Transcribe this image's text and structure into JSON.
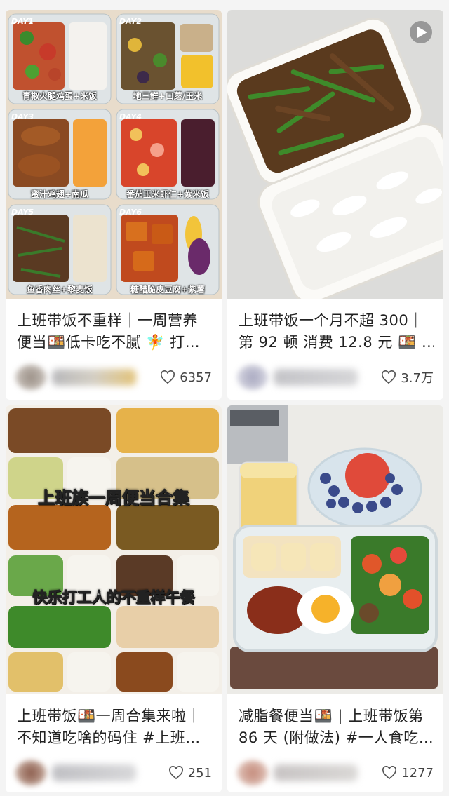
{
  "cards": [
    {
      "title_line1": "上班带饭不重样｜一周营养",
      "title_line2": "便当🍱低卡吃不腻 🧚 打…",
      "likes": "6357",
      "days": [
        {
          "tag": "DAY1",
          "caption": "青椒火腿鸡蛋+米饭"
        },
        {
          "tag": "DAY2",
          "caption": "地三鲜+口蘑/玉米"
        },
        {
          "tag": "DAY3",
          "caption": "蜜汁鸡翅+南瓜"
        },
        {
          "tag": "DAY4",
          "caption": "番茄玉米虾仁+紫米饭"
        },
        {
          "tag": "DAY5",
          "caption": "鱼香肉丝+黎麦饭"
        },
        {
          "tag": "DAY6",
          "caption": "糖醋脆皮豆腐+紫薯"
        }
      ]
    },
    {
      "title_line1": "上班带饭一个月不超 300｜",
      "title_line2": "第 92 顿 消费 12.8 元 🍱 …",
      "likes": "3.7万",
      "video_icon": "play-icon"
    },
    {
      "title_line1": "上班带饭🍱一周合集来啦｜",
      "title_line2": "不知道吃啥的码住 #上班…",
      "likes": "251",
      "overlay_1": "上班族一周便当合集",
      "overlay_2": "快乐打工人的不重样午餐"
    },
    {
      "title_line1": "减脂餐便当🍱 | 上班带饭第",
      "title_line2": "86 天 (附做法) #一人食吃…",
      "likes": "1277"
    }
  ],
  "colors": {
    "background": "#f4f4f4",
    "card": "#ffffff",
    "text": "#222222",
    "like_text": "#444444"
  },
  "icons": {
    "like": "heart-outline-icon",
    "video": "play-icon"
  }
}
